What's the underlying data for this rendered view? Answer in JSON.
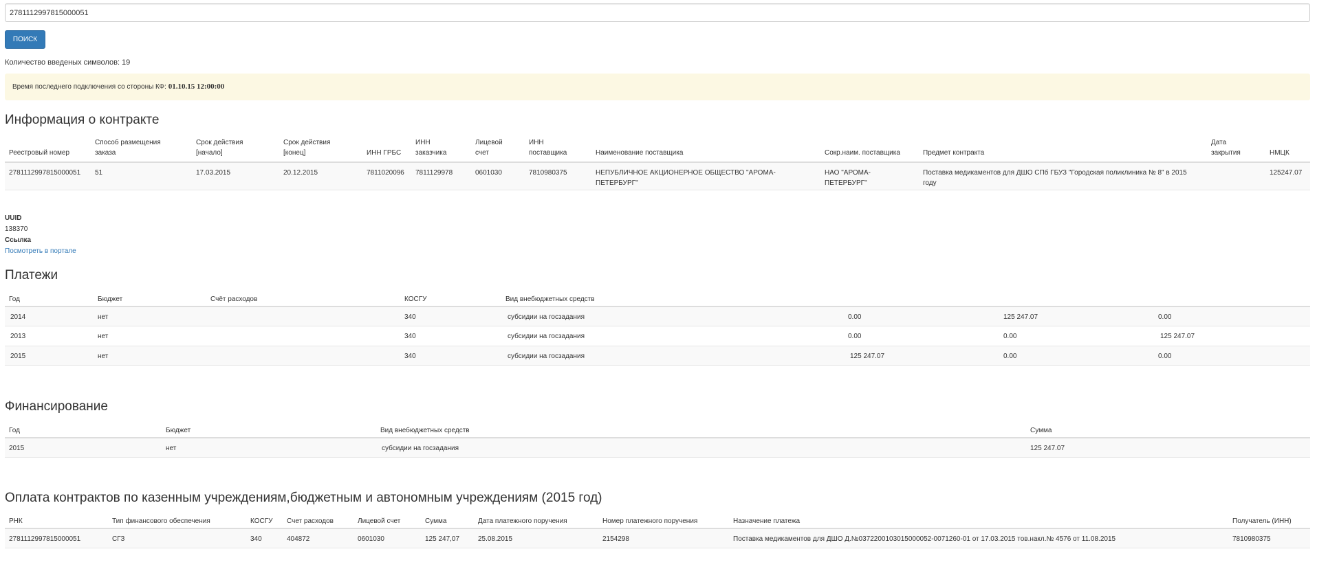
{
  "search": {
    "value": "2781112997815000051",
    "button": "ПОИСК",
    "char_count": "Количество введеных символов: 19"
  },
  "alert": {
    "text": "Время последнего подключения со стороны КФ: ",
    "time": "01.10.15 12:00:00"
  },
  "contract": {
    "title": "Информация о контракте",
    "headers": [
      "Реестровый номер",
      "Способ размещения заказа",
      "Срок действия [начало]",
      "Срок действия [конец]",
      "ИНН ГРБС",
      "ИНН заказчика",
      "Лицевой счет",
      "ИНН поставщика",
      "Наименование поставщика",
      "Сокр.наим. поставщика",
      "Предмет контракта",
      "Дата закрытия",
      "НМЦК"
    ],
    "row": [
      "2781112997815000051",
      "51",
      "17.03.2015",
      "20.12.2015",
      "7811020096",
      "7811129978",
      "0601030",
      "7810980375",
      "НЕПУБЛИЧНОЕ АКЦИОНЕРНОЕ ОБЩЕСТВО \"АРОМА-ПЕТЕРБУРГ\"",
      "НАО \"АРОМА-ПЕТЕРБУРГ\"",
      "Поставка медикаментов для ДШО СПб ГБУЗ \"Городская поликлиника № 8\" в 2015 году",
      "",
      "125247.07"
    ]
  },
  "meta": {
    "uuid_label": "UUID",
    "uuid_value": "138370",
    "link_label": "Ссылка",
    "link_text": "Посмотреть в портале"
  },
  "payments": {
    "title": "Платежи",
    "headers": [
      "Год",
      "Бюджет",
      "Счёт расходов",
      "КОСГУ",
      "Вид внебюджетных средств",
      "",
      "",
      ""
    ],
    "rows": [
      [
        "2014",
        "нет",
        "",
        "340",
        "субсидии на госзадания",
        "0.00",
        "125 247.07",
        "0.00"
      ],
      [
        "2013",
        "нет",
        "",
        "340",
        "субсидии на госзадания",
        "0.00",
        "0.00",
        "125 247.07"
      ],
      [
        "2015",
        "нет",
        "",
        "340",
        "субсидии на госзадания",
        "125 247.07",
        "0.00",
        "0.00"
      ]
    ]
  },
  "financing": {
    "title": "Финансирование",
    "headers": [
      "Год",
      "Бюджет",
      "Вид внебюджетных средств",
      "Сумма"
    ],
    "rows": [
      [
        "2015",
        "нет",
        "субсидии на госзадания",
        "125 247.07"
      ]
    ]
  },
  "pay_contracts": {
    "title": "Оплата контрактов по казенным учреждениям,бюджетным и автономным учреждениям (2015 год)",
    "headers": [
      "РНК",
      "Тип финансового обеспечения",
      "КОСГУ",
      "Счет расходов",
      "Лицевой счет",
      "Сумма",
      "Дата платежного поручения",
      "Номер платежного поручения",
      "Назначение платежа",
      "Получатель (ИНН)"
    ],
    "rows": [
      [
        "2781112997815000051",
        "СГЗ",
        "340",
        "404872",
        "0601030",
        "125 247,07",
        "25.08.2015",
        "2154298",
        "Поставка медикаментов для ДШО Д.№0372200103015000052-0071260-01 от 17.03.2015 тов.накл.№ 4576 от 11.08.2015",
        "7810980375"
      ]
    ]
  }
}
